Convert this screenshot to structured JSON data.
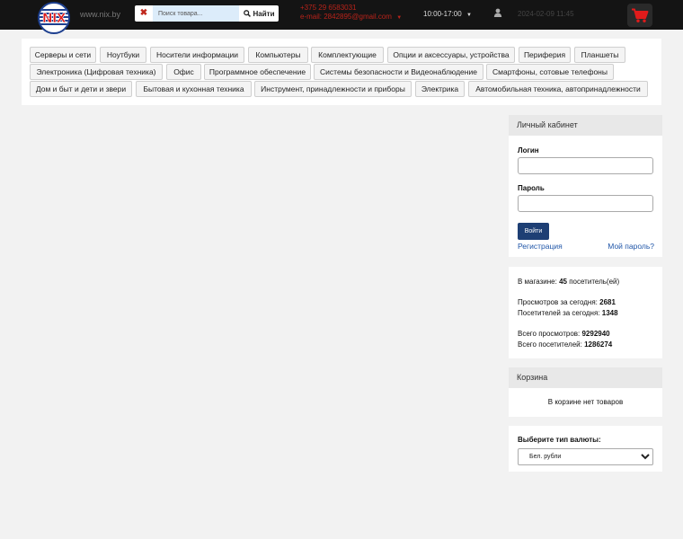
{
  "header": {
    "logo_text": "NIX",
    "site_url": "www.nix.by",
    "search": {
      "clear_symbol": "✖",
      "placeholder": "Поиск товара...",
      "button_label": "Найти"
    },
    "contacts": {
      "phone": "+375 29 6583031",
      "email": "e-mail: 2842895@gmail.com",
      "hours": "10:00-17:00"
    },
    "datetime": "2024-02-09 11:45",
    "colors": {
      "bar": "#141414",
      "accent": "#b8231a",
      "cart": "#e01b1b"
    }
  },
  "categories": [
    "Серверы и сети",
    "Ноутбуки",
    "Носители информации",
    "Компьютеры",
    "Комплектующие",
    "Опции и аксессуары, устройства",
    "Периферия",
    "Планшеты",
    "Электроника (Цифровая техника)",
    "Офис",
    "Программное обеспечение",
    "Системы безопасности и Видеонаблюдение",
    "Смартфоны, сотовые телефоны",
    "Дом и быт и дети и звери",
    "Бытовая и кухонная техника",
    "Инструмент, принадлежности и приборы",
    "Электрика",
    "Автомобильная техника, автопринадлежности"
  ],
  "account": {
    "title": "Личный кабинет",
    "login_label": "Логин",
    "password_label": "Пароль",
    "login_button": "Войти",
    "register_link": "Регистрация",
    "forgot_link": "Мой пароль?"
  },
  "stats": {
    "online_prefix": "В магазине:",
    "online_count": "45",
    "online_suffix": "посетитель(ей)",
    "views_today_label": "Просмотров за сегодня:",
    "views_today": "2681",
    "visitors_today_label": "Посетителей за сегодня:",
    "visitors_today": "1348",
    "views_total_label": "Всего просмотров:",
    "views_total": "9292940",
    "visitors_total_label": "Всего посетителей:",
    "visitors_total": "1286274"
  },
  "cart": {
    "title": "Корзина",
    "empty_text": "В корзине нет товаров"
  },
  "currency": {
    "label": "Выберите тип валюты:",
    "selected": "Бел. рубли"
  }
}
